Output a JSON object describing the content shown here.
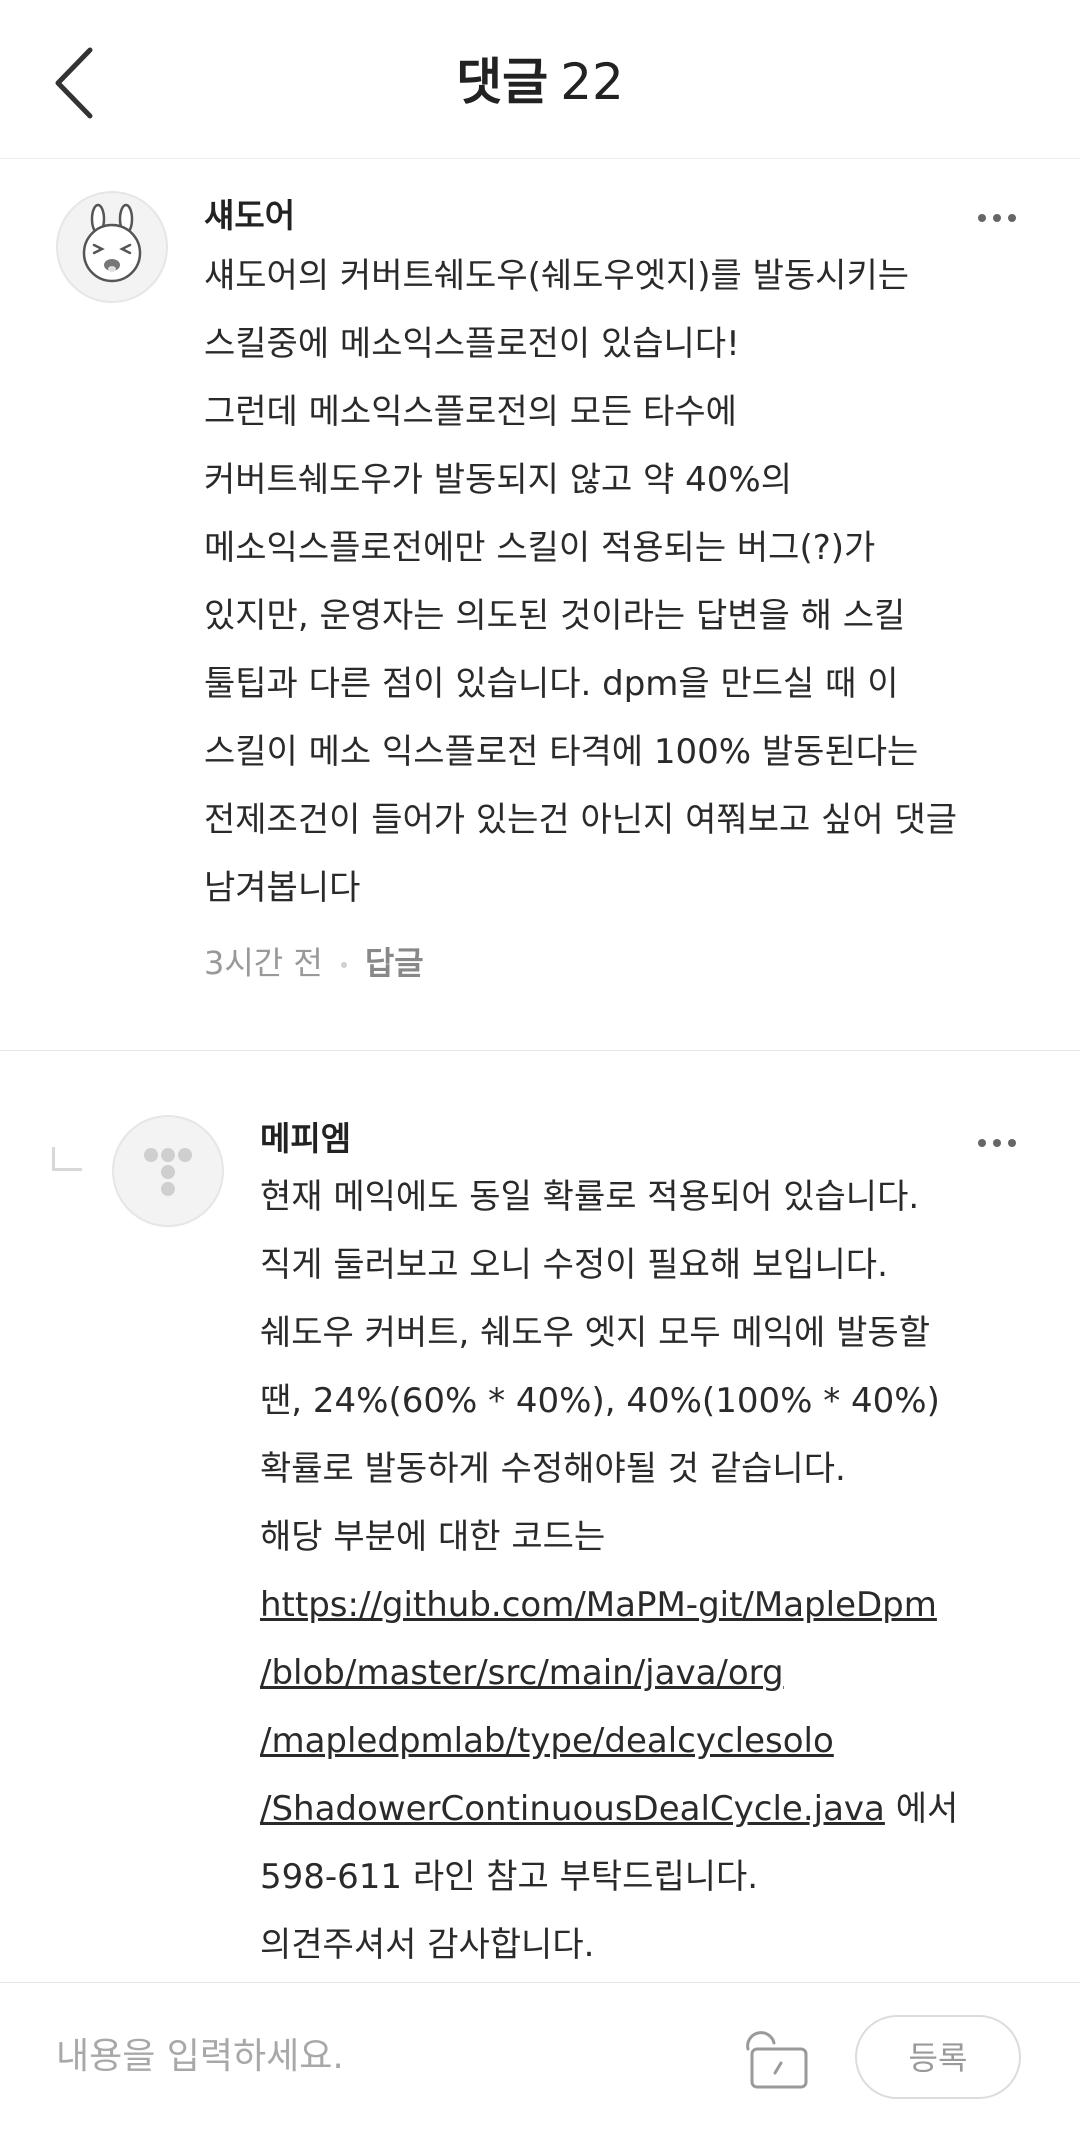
{
  "header": {
    "title": "댓글",
    "count": "22",
    "back_icon": "chevron-left-icon"
  },
  "comments": [
    {
      "author": "섀도어",
      "avatar_icon": "bunny-avatar-icon",
      "more_icon": "more-horizontal-icon",
      "lines": [
        "섀도어의 커버트쉐도우(쉐도우엣지)를 발동시키는",
        "스킬중에 메소익스플로전이 있습니다!",
        "그런데 메소익스플로전의 모든 타수에",
        "커버트쉐도우가 발동되지 않고 약 40%의",
        "메소익스플로전에만 스킬이 적용되는 버그(?)가",
        "있지만, 운영자는 의도된 것이라는 답변을 해 스킬",
        "툴팁과 다른 점이 있습니다. dpm을 만드실 때 이",
        "스킬이 메소 익스플로전 타격에 100% 발동된다는",
        "전제조건이 들어가 있는건 아닌지 여쭤보고 싶어 댓글",
        "남겨봅니다"
      ],
      "time": "3시간 전",
      "reply_label": "답글"
    },
    {
      "author": "메피엠",
      "avatar_icon": "dots-logo-avatar-icon",
      "more_icon": "more-horizontal-icon",
      "lines": [
        "현재 메익에도 동일 확률로 적용되어 있습니다.",
        "직게 둘러보고 오니 수정이 필요해 보입니다.",
        "쉐도우 커버트, 쉐도우 엣지 모두 메익에 발동할",
        "땐, 24%(60% * 40%), 40%(100% * 40%)",
        "확률로 발동하게 수정해야될 것 같습니다.",
        "해당 부분에 대한 코드는"
      ],
      "link_lines": [
        "https://github.com/MaPM-git/MapleDpm",
        "/blob/master/src/main/java/org",
        "/mapledpmlab/type/dealcyclesolo",
        "/ShadowerContinuousDealCycle.java"
      ],
      "link_suffix": " 에서",
      "after_lines": [
        "598-611 라인 참고 부탁드립니다.",
        "의견주셔서 감사합니다."
      ]
    }
  ],
  "input_bar": {
    "placeholder": "내용을 입력하세요.",
    "value": "",
    "lock_icon": "unlock-icon",
    "submit_label": "등록"
  },
  "colors": {
    "text": "#222222",
    "muted": "#999999",
    "divider": "#e8e8e8",
    "button_border": "#dcdcdc"
  }
}
